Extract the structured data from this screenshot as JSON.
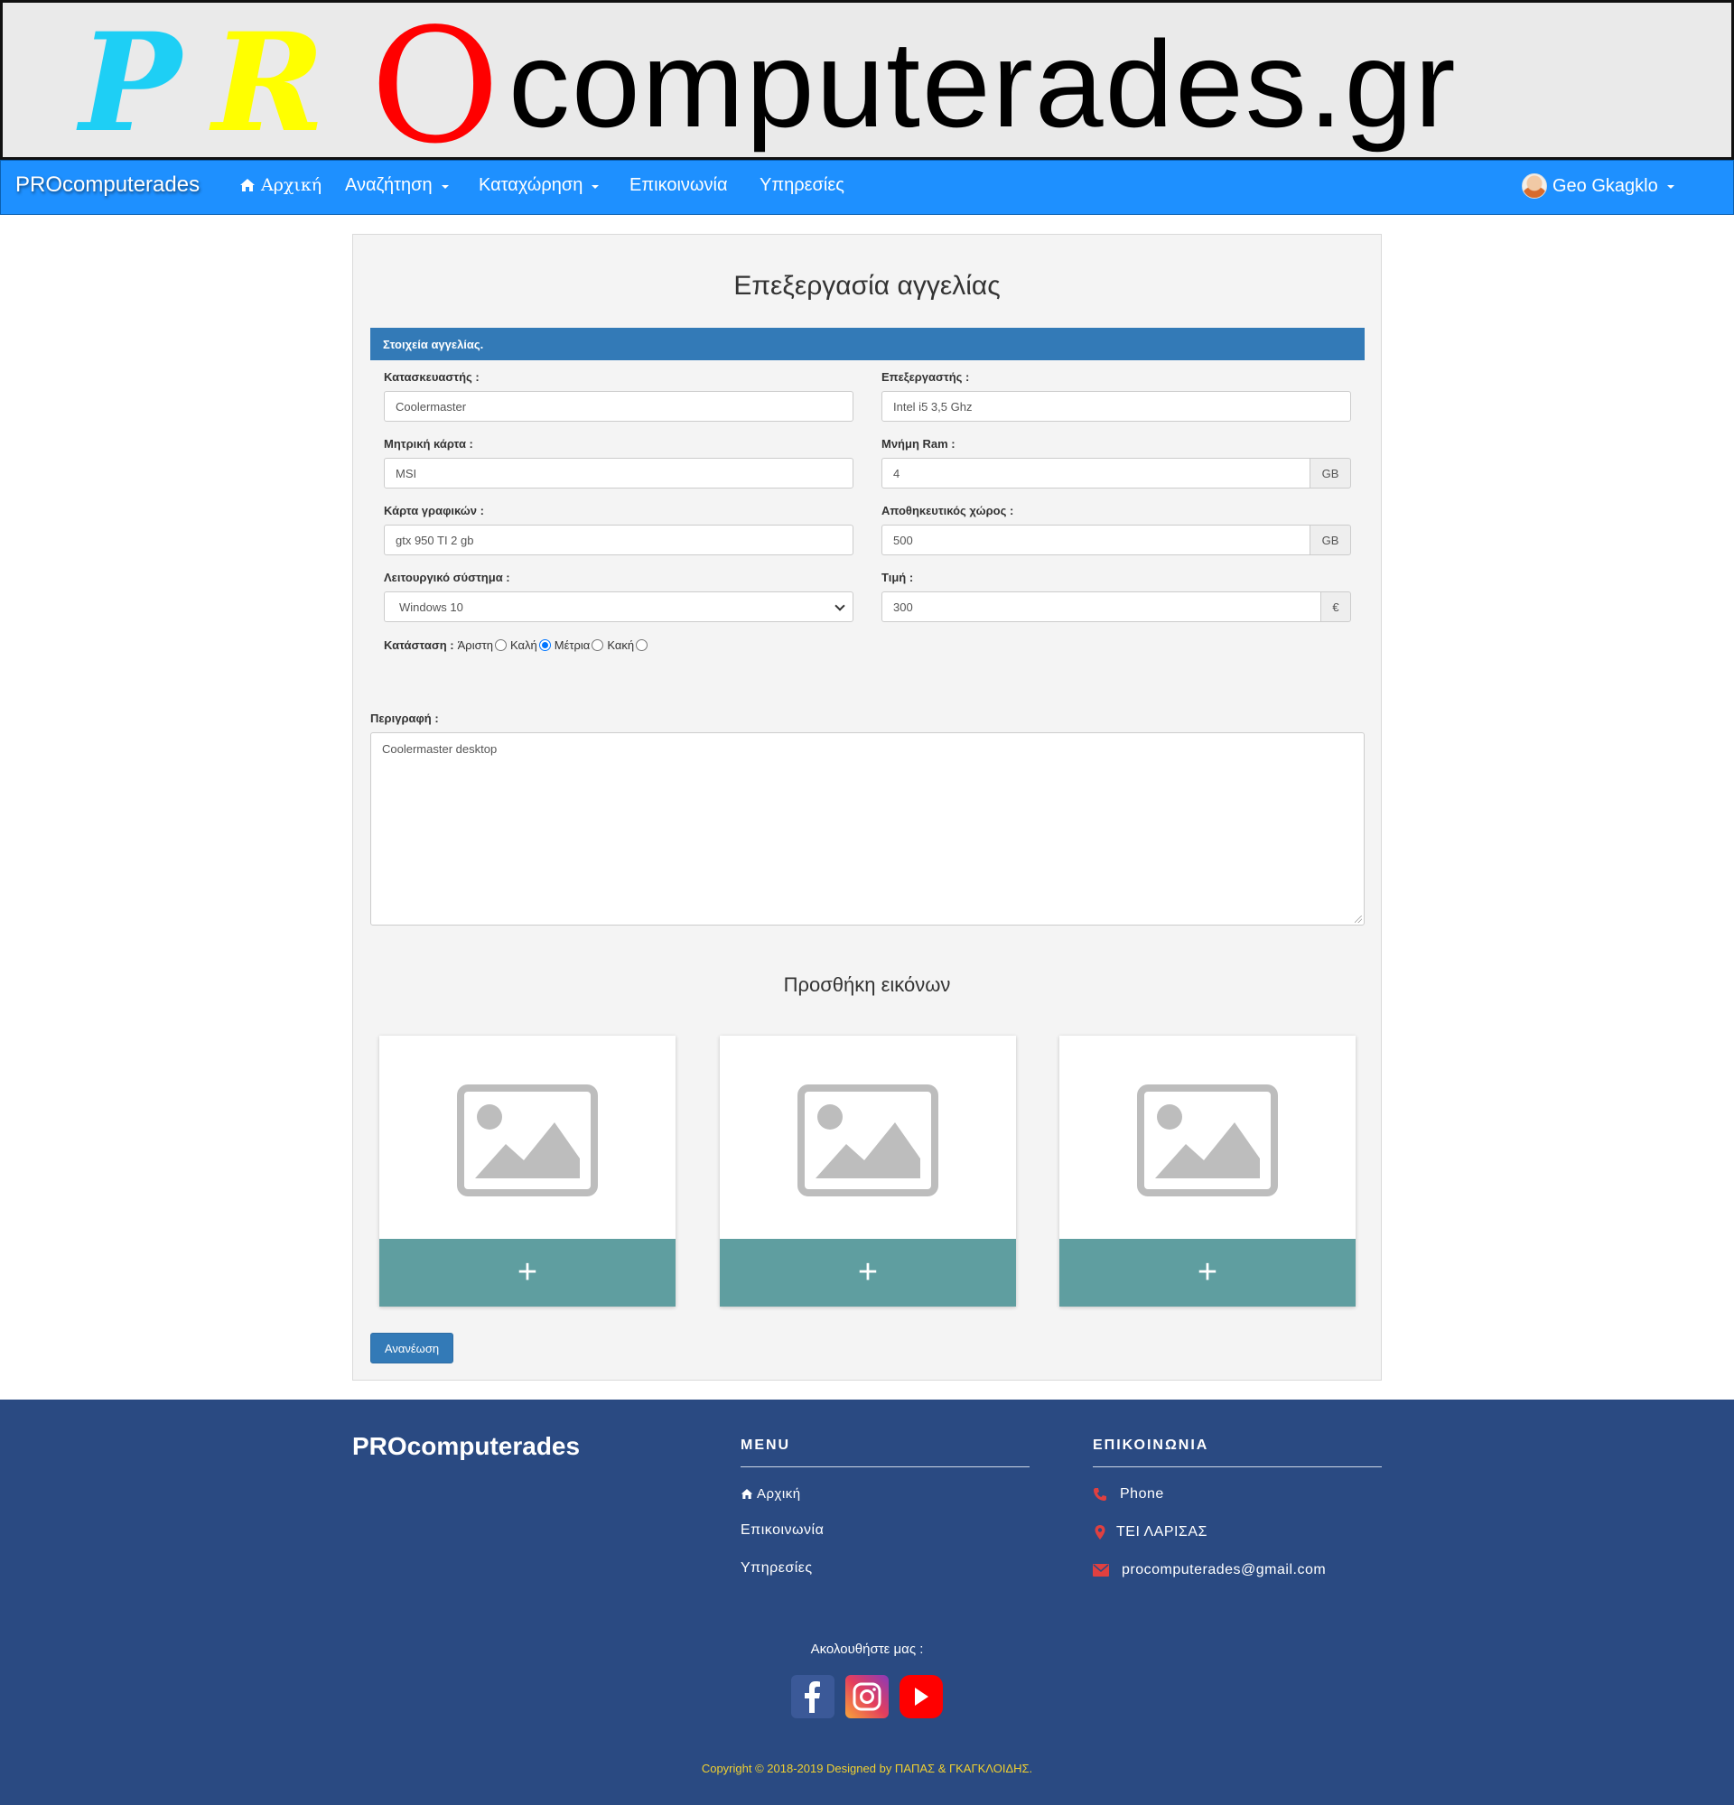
{
  "banner": {
    "logo_p": "P",
    "logo_r": "R",
    "logo_o": "O",
    "logo_word": "computerades.gr",
    "colors": {
      "p": "#1ecff5",
      "r": "#ffff00",
      "o": "#ff0000"
    }
  },
  "navbar": {
    "brand": "PROcomputerades",
    "home": "Αρχική",
    "search": "Αναζήτηση",
    "register": "Καταχώρηση",
    "contact": "Επικοινωνία",
    "services": "Υπηρεσίες",
    "user": "Geo Gkagklo",
    "accent": "#1e90ff"
  },
  "form": {
    "title": "Επεξεργασία αγγελίας",
    "section": "Στοιχεία αγγελίας.",
    "manufacturer": {
      "label": "Κατασκευαστής :",
      "value": "Coolermaster"
    },
    "processor": {
      "label": "Επεξεργαστής :",
      "value": "Intel i5 3,5 Ghz"
    },
    "motherboard": {
      "label": "Μητρική κάρτα :",
      "value": "MSI"
    },
    "ram": {
      "label": "Μνήμη Ram :",
      "value": "4",
      "unit": "GB"
    },
    "gpu": {
      "label": "Κάρτα γραφικών :",
      "value": "gtx 950 TI 2 gb"
    },
    "storage": {
      "label": "Αποθηκευτικός χώρος :",
      "value": "500",
      "unit": "GB"
    },
    "os": {
      "label": "Λειτουργικό σύστημα :",
      "value": "Windows 10"
    },
    "price": {
      "label": "Τιμή :",
      "value": "300",
      "unit": "€"
    },
    "condition": {
      "label": "Κατάσταση :",
      "options": [
        "Άριστη",
        "Καλή",
        "Μέτρια",
        "Κακή"
      ],
      "selected": "Μέτρια"
    },
    "description": {
      "label": "Περιγραφή :",
      "value": "Coolermaster desktop"
    },
    "images_title": "Προσθήκη εικόνων",
    "add_symbol": "+",
    "update_button": "Ανανέωση"
  },
  "footer": {
    "brand": "PROcomputerades",
    "menu_head": "MENU",
    "menu": [
      "Αρχική",
      "Επικοινωνία",
      "Υπηρεσίες"
    ],
    "contact_head": "ΕΠΙΚΟΙΝΩΝΙΑ",
    "phone": "Phone",
    "address": "ΤΕΙ ΛΑΡΙΣΑΣ",
    "email": "procomputerades@gmail.com",
    "follow": "Ακολουθήστε μας :",
    "social": [
      "facebook-icon",
      "instagram-icon",
      "youtube-icon"
    ],
    "copyright": "Copyright © 2018-2019 Designed by ΠΑΠΑΣ & ΓΚΑΓΚΛΟΙΔΗΣ.",
    "background": "#2a4a82",
    "icon_color": "#e04040"
  }
}
